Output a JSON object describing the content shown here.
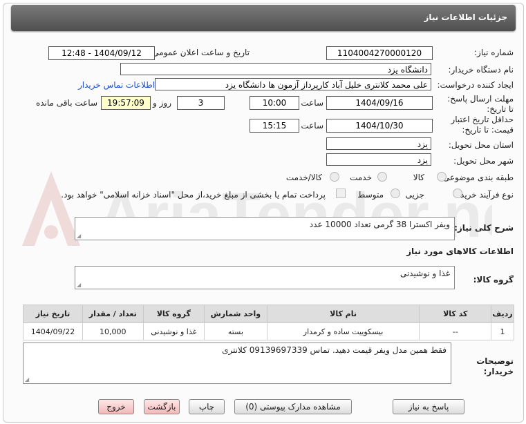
{
  "header": {
    "title": "جزئیات اطلاعات نیاز"
  },
  "need": {
    "number_label": "شماره نیاز:",
    "number": "1104004270000120",
    "announce_label": "تاریخ و ساعت اعلان عمومی:",
    "announce_value": "1404/09/12 - 12:48"
  },
  "buyer": {
    "label": "نام دستگاه خریدار:",
    "value": "دانشگاه یزد"
  },
  "requester": {
    "label": "ایجاد کننده درخواست:",
    "value": "علی محمد کلانتری خلیل آباد کارپرداز آزمون ها دانشگاه یزد",
    "contact_link": "اطلاعات تماس خریدار"
  },
  "deadline": {
    "label": "مهلت ارسال پاسخ: تا تاریخ:",
    "date": "1404/09/16",
    "time_label": "ساعت",
    "time": "10:00",
    "days": "3",
    "days_label": "روز و",
    "remaining": "19:57:09",
    "remaining_label": "ساعت باقی مانده"
  },
  "validity": {
    "label": "حداقل تاریخ اعتبار قیمت: تا تاریخ:",
    "date": "1404/10/30",
    "time_label": "ساعت",
    "time": "15:15"
  },
  "province": {
    "label": "استان محل تحویل:",
    "value": "یزد"
  },
  "city": {
    "label": "شهر محل تحویل:",
    "value": "یزد"
  },
  "category": {
    "label": "طبقه بندی موضوعی:",
    "options": [
      "کالا",
      "خدمت",
      "کالا/خدمت"
    ]
  },
  "purchase": {
    "label": "نوع فرآیند خرید :",
    "options": [
      "جزیی",
      "متوسط"
    ],
    "note": "پرداخت تمام یا بخشی از مبلغ خرید،از محل \"اسناد خزانه اسلامی\" خواهد بود."
  },
  "description": {
    "label": "شرح کلی نیاز:",
    "value": "ویفر اکسترا 38 گرمی تعداد 10000 عدد"
  },
  "goods_info": {
    "label": "اطلاعات کالاهای مورد نیاز"
  },
  "group": {
    "label": "گروه کالا:",
    "value": "غذا و نوشیدنی"
  },
  "table": {
    "headers": [
      "ردیف",
      "کد کالا",
      "نام کالا",
      "واحد شمارش",
      "گروه کالا",
      "تعداد / مقدار",
      "تاریخ نیاز"
    ],
    "rows": [
      [
        "1",
        "--",
        "بیسکوییت ساده و کرمدار",
        "بسته",
        "غذا و نوشیدنی",
        "10,000",
        "1404/09/22"
      ]
    ]
  },
  "buyer_notes": {
    "label": "توضیحات خریدار:",
    "value": "فقط همین مدل ویفر قیمت دهید. تماس 09139697339 کلانتری"
  },
  "buttons": {
    "reply": "پاسخ به نیاز",
    "attachments": "مشاهده مدارک پیوستی (0)",
    "print": "چاپ",
    "back": "بازگشت",
    "exit": "خروج"
  },
  "watermark": {
    "text": "AriaTender.net"
  },
  "colors": {
    "header_bg": "#5f5f5f",
    "link": "#1a4fd6",
    "highlight": "#ffffcc"
  }
}
